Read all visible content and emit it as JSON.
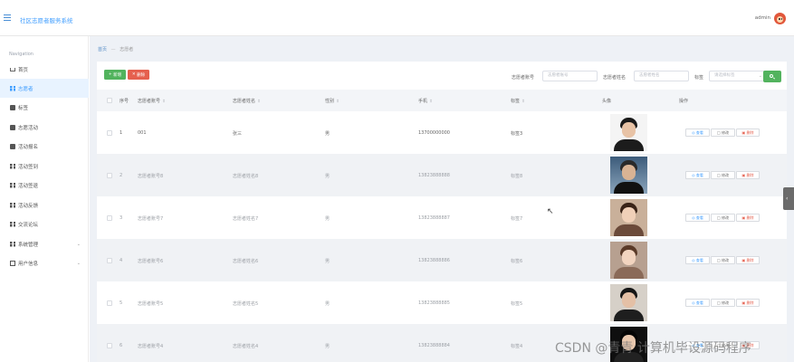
{
  "header": {
    "title": "社区志愿者服务系统",
    "user": "admin"
  },
  "sidebar": {
    "section_title": "Navigation",
    "items": [
      {
        "label": "首页",
        "icon": "home-icon"
      },
      {
        "label": "志愿者",
        "icon": "grid-icon",
        "active": true
      },
      {
        "label": "标签",
        "icon": "tag-icon"
      },
      {
        "label": "志愿活动",
        "icon": "activity-icon"
      },
      {
        "label": "活动报名",
        "icon": "signup-icon"
      },
      {
        "label": "活动签到",
        "icon": "grid-icon"
      },
      {
        "label": "活动签退",
        "icon": "grid-icon"
      },
      {
        "label": "活动反馈",
        "icon": "grid-icon"
      },
      {
        "label": "交流论坛",
        "icon": "grid-icon"
      },
      {
        "label": "系统管理",
        "icon": "grid-icon",
        "expandable": true
      },
      {
        "label": "用户信息",
        "icon": "user-card-icon",
        "expandable": true
      }
    ]
  },
  "breadcrumb": {
    "home": "首页",
    "separator": "—",
    "current": "志愿者"
  },
  "toolbar": {
    "add_label": "新增",
    "delete_label": "删除",
    "filters": [
      {
        "label": "志愿者账号",
        "placeholder": "志愿者账号"
      },
      {
        "label": "志愿者姓名",
        "placeholder": "志愿者姓名"
      },
      {
        "label": "标签",
        "placeholder": "请选择标签"
      }
    ]
  },
  "table": {
    "columns": [
      "序号",
      "志愿者账号",
      "志愿者姓名",
      "性别",
      "手机",
      "标签",
      "头像",
      "操作"
    ],
    "sortable_columns": [
      "志愿者账号",
      "志愿者姓名",
      "性别",
      "手机",
      "标签"
    ],
    "rows": [
      {
        "index": "1",
        "account": "001",
        "name": "张三",
        "gender": "男",
        "phone": "13700000000",
        "tag": "标签3"
      },
      {
        "index": "2",
        "account": "志愿者账号8",
        "name": "志愿者姓名8",
        "gender": "男",
        "phone": "13823888888",
        "tag": "标签8"
      },
      {
        "index": "3",
        "account": "志愿者账号7",
        "name": "志愿者姓名7",
        "gender": "男",
        "phone": "13823888887",
        "tag": "标签7"
      },
      {
        "index": "4",
        "account": "志愿者账号6",
        "name": "志愿者姓名6",
        "gender": "男",
        "phone": "13823888886",
        "tag": "标签6"
      },
      {
        "index": "5",
        "account": "志愿者账号5",
        "name": "志愿者姓名5",
        "gender": "男",
        "phone": "13823888885",
        "tag": "标签5"
      },
      {
        "index": "6",
        "account": "志愿者账号4",
        "name": "志愿者姓名4",
        "gender": "男",
        "phone": "13823888884",
        "tag": "标签4"
      }
    ],
    "actions": {
      "view": "查看",
      "edit": "修改",
      "delete": "删除"
    }
  },
  "watermark": "CSDN @青青 计算机毕设源码程序",
  "colors": {
    "primary": "#409eff",
    "success": "#52b35e",
    "danger": "#e5604e",
    "background": "#eef1f6"
  }
}
